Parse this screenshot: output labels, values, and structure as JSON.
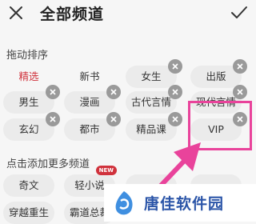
{
  "header": {
    "close_icon": "close-icon",
    "title": "全部频道",
    "confirm_icon": "check-icon"
  },
  "sections": {
    "sort_label": "拖动排序",
    "add_more_label": "点击添加更多频道"
  },
  "my_channels": [
    {
      "label": "精选"
    },
    {
      "label": "新书"
    },
    {
      "label": "女生"
    },
    {
      "label": "出版"
    },
    {
      "label": "男生"
    },
    {
      "label": "漫画"
    },
    {
      "label": "古代言情"
    },
    {
      "label": "现代言情"
    },
    {
      "label": "玄幻"
    },
    {
      "label": "都市"
    },
    {
      "label": "精品课"
    },
    {
      "label": "VIP"
    }
  ],
  "more_channels": [
    {
      "label": "奇文"
    },
    {
      "label": "轻小说",
      "badge": "NEW"
    },
    {
      "label": ""
    },
    {
      "label": ""
    },
    {
      "label": "穿越重生"
    },
    {
      "label": "霸道总裁"
    }
  ],
  "watermark": {
    "text": "唐佳软件园"
  },
  "colors": {
    "accent_red": "#d0323c",
    "highlight_pink": "#e9439b",
    "watermark_blue": "#2b55a8"
  }
}
